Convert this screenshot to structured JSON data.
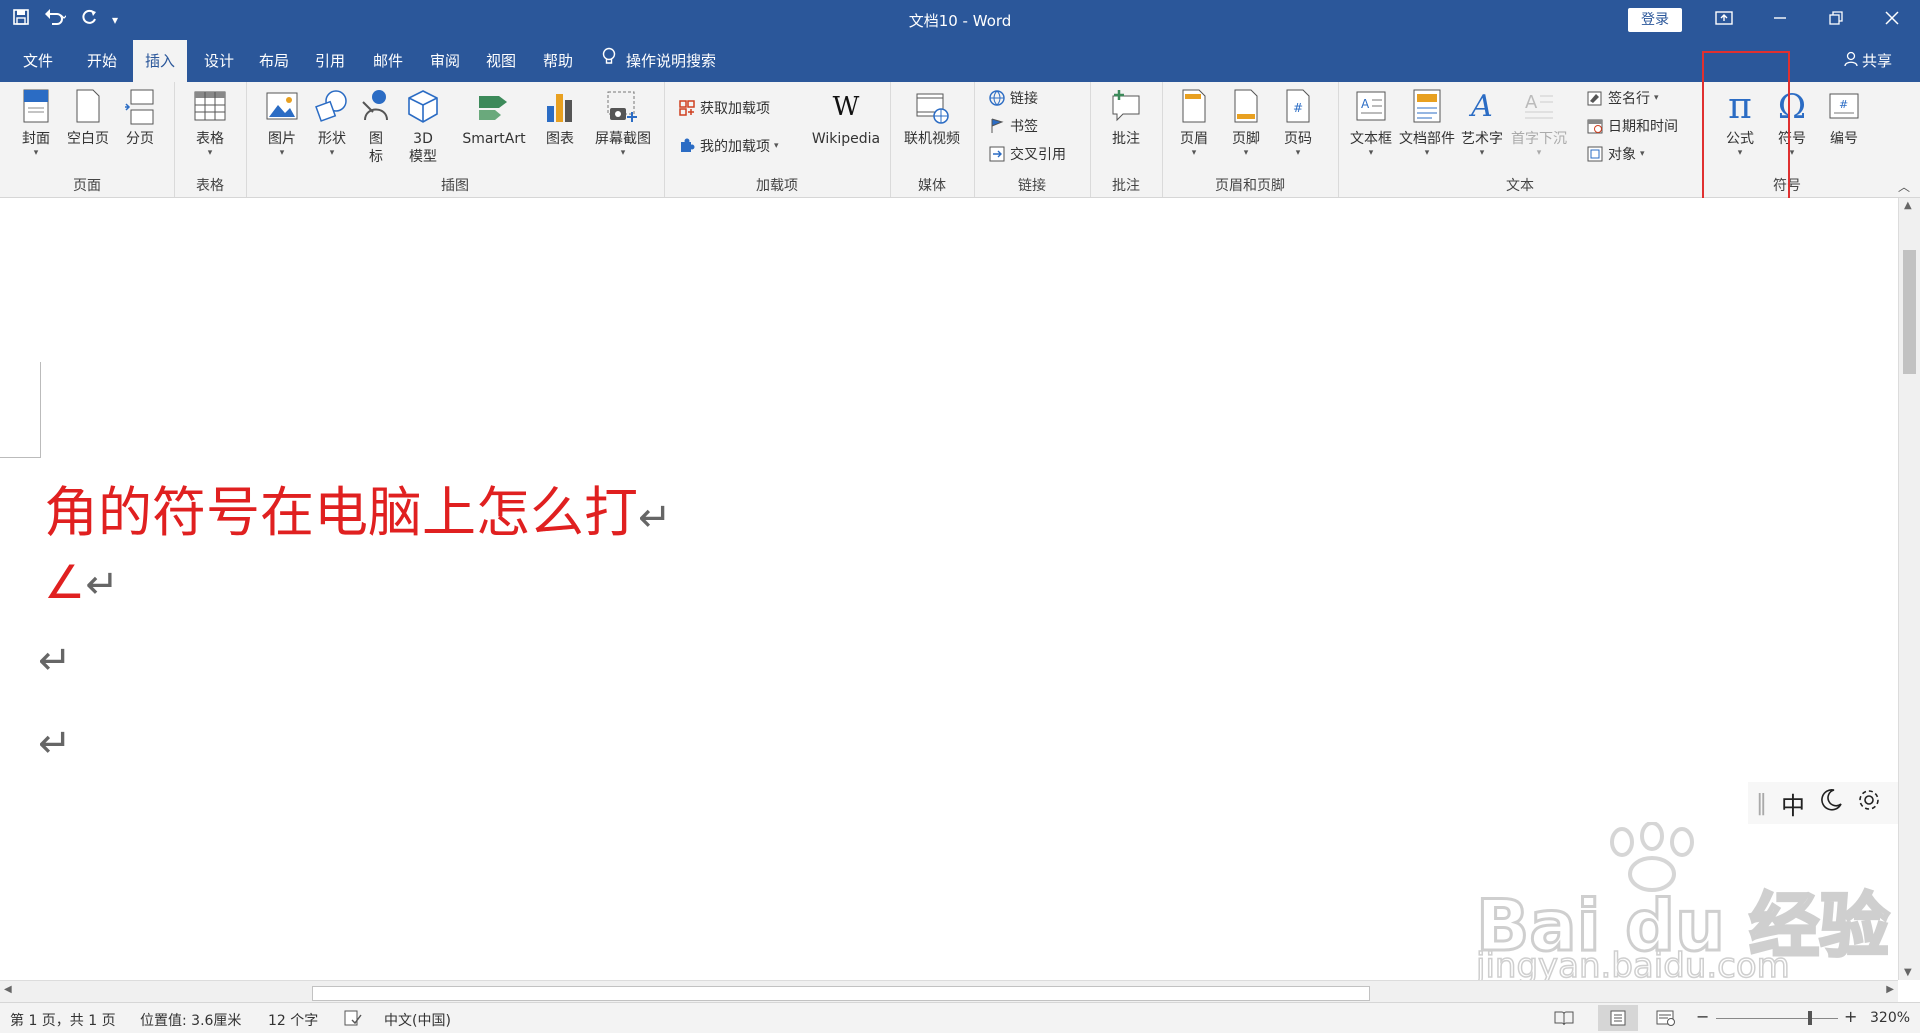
{
  "window": {
    "title": "文档10  -  Word",
    "login_label": "登录",
    "buttons": [
      "restore-ribbon-icon",
      "minimize-icon",
      "restore-icon",
      "close-icon"
    ]
  },
  "qat": {
    "icons": [
      "save-icon",
      "undo-icon",
      "redo-icon",
      "customize-icon"
    ]
  },
  "menu": {
    "tabs": [
      "文件",
      "开始",
      "插入",
      "设计",
      "布局",
      "引用",
      "邮件",
      "审阅",
      "视图",
      "帮助"
    ],
    "active_tab": "插入",
    "tellme": "操作说明搜索",
    "share": "共享"
  },
  "ribbon": {
    "groups": [
      {
        "name": "页面",
        "buttons": [
          "封面",
          "空白页",
          "分页"
        ]
      },
      {
        "name": "表格",
        "buttons": [
          "表格"
        ]
      },
      {
        "name": "插图",
        "buttons": [
          "图片",
          "形状",
          "图标",
          "3D模型",
          "SmartArt",
          "图表",
          "屏幕截图"
        ],
        "icon_label_lines": [
          "图",
          "标"
        ],
        "model_label_lines": [
          "3D",
          "模型"
        ]
      },
      {
        "name": "加载项",
        "buttons": [
          "获取加载项",
          "我的加载项",
          "Wikipedia"
        ]
      },
      {
        "name": "媒体",
        "buttons": [
          "联机视频"
        ]
      },
      {
        "name": "链接",
        "buttons": [
          "链接",
          "书签",
          "交叉引用"
        ]
      },
      {
        "name": "批注",
        "buttons": [
          "批注"
        ]
      },
      {
        "name": "页眉和页脚",
        "buttons": [
          "页眉",
          "页脚",
          "页码"
        ]
      },
      {
        "name": "文本",
        "buttons": [
          "文本框",
          "文档部件",
          "艺术字",
          "首字下沉",
          "签名行",
          "日期和时间",
          "对象"
        ]
      },
      {
        "name": "符号",
        "buttons": [
          "公式",
          "符号",
          "编号"
        ]
      }
    ]
  },
  "document": {
    "lines": [
      "角的符号在电脑上怎么打",
      "∠",
      "",
      ""
    ],
    "paragraph_mark": "↵",
    "ime": {
      "mode": "中"
    }
  },
  "statusbar": {
    "page": "第 1 页，共 1 页",
    "position": "位置值: 3.6厘米",
    "words": "12 个字",
    "language": "中文(中国)",
    "zoom": "320%"
  },
  "watermark": {
    "line1": "Bai  du 经验",
    "line2": "jingyan.baidu.com"
  }
}
